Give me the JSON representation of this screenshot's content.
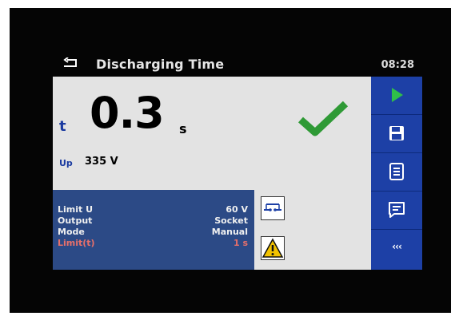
{
  "header": {
    "title": "Discharging Time",
    "clock": "08:28"
  },
  "result": {
    "symbol": "t",
    "value": "0.3",
    "unit": "s",
    "status": "pass"
  },
  "sub_result": {
    "label": "Up",
    "value": "335 V"
  },
  "limits": [
    {
      "label": "Limit U",
      "value": "60 V",
      "highlight": false
    },
    {
      "label": "Output",
      "value": "Socket",
      "highlight": false
    },
    {
      "label": "Mode",
      "value": "Manual",
      "highlight": false
    },
    {
      "label": "Limit(t)",
      "value": "1 s",
      "highlight": true
    }
  ],
  "sidebar": {
    "more_label": "‹‹‹"
  },
  "icons": [
    "back-arrow-icon",
    "checkmark-icon",
    "connection-icon",
    "warning-icon",
    "play-icon",
    "save-icon",
    "document-icon",
    "comment-icon"
  ],
  "colors": {
    "pass_green": "#2f9a36",
    "accent_blue": "#1d40a6",
    "limit_red": "#e8706a"
  }
}
